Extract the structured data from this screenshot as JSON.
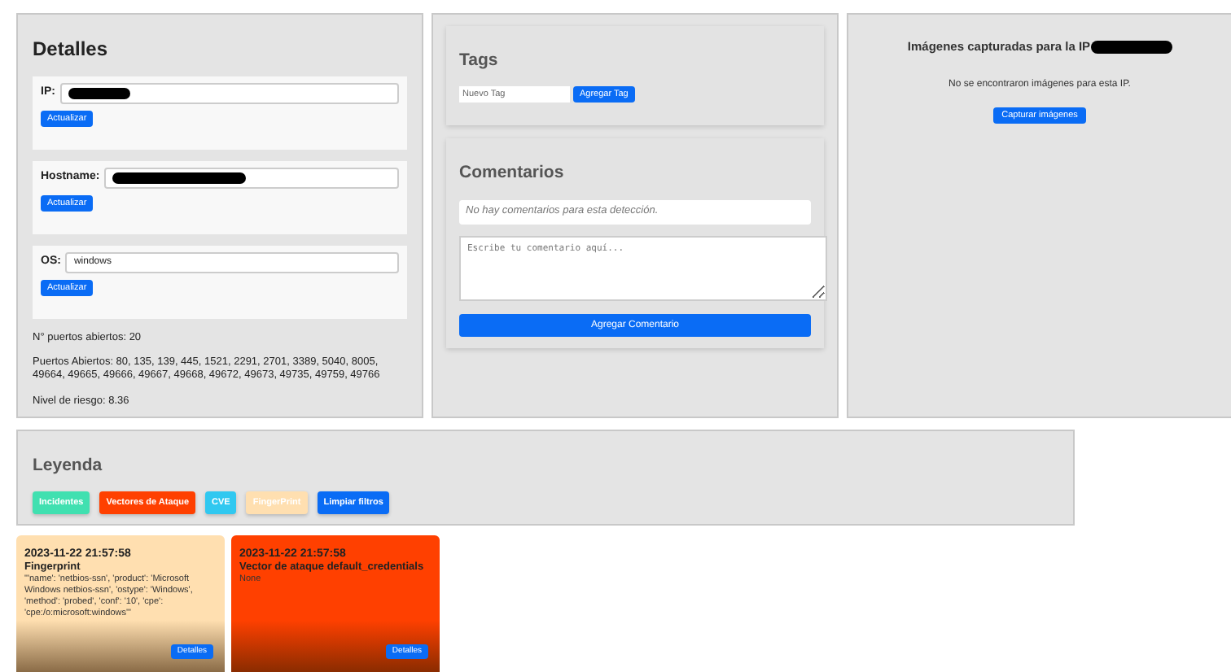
{
  "details": {
    "title": "Detalles",
    "fields": [
      {
        "label": "IP:",
        "value_redacted": true,
        "button": "Actualizar"
      },
      {
        "label": "Hostname:",
        "value_redacted": true,
        "button": "Actualizar"
      },
      {
        "label": "OS:",
        "value": "windows",
        "button": "Actualizar"
      }
    ],
    "open_ports_count": "N° puertos abiertos: 20",
    "open_ports": "Puertos Abiertos: 80, 135, 139, 445, 1521, 2291, 2701, 3389, 5040, 8005, 49664, 49665, 49666, 49667, 49668, 49672, 49673, 49735, 49759, 49766",
    "risk": "Nivel de riesgo: 8.36"
  },
  "tags": {
    "title": "Tags",
    "placeholder": "Nuevo Tag",
    "button": "Agregar Tag"
  },
  "comments": {
    "title": "Comentarios",
    "empty": "No hay comentarios para esta detección.",
    "placeholder": "Escribe tu comentario aquí...",
    "button": "Agregar Comentario"
  },
  "images": {
    "title": "Imágenes capturadas para la IP",
    "ip_redacted": true,
    "empty": "No se encontraron imágenes para esta IP.",
    "button": "Capturar imágenes"
  },
  "legend": {
    "title": "Leyenda",
    "items": [
      {
        "label": "Incidentes",
        "color": "#40e0b0"
      },
      {
        "label": "Vectores de Ataque",
        "color": "#ff4000"
      },
      {
        "label": "CVE",
        "color": "#30c8f0"
      },
      {
        "label": "FingerPrint",
        "color": "#ffdfb0"
      },
      {
        "label": "Limpiar filtros",
        "color": "#0a6cf5"
      }
    ]
  },
  "cards": [
    {
      "date": "2023-11-22 21:57:58",
      "title": "Fingerprint",
      "body": "\"'name': 'netbios-ssn', 'product': 'Microsoft Windows netbios-ssn', 'ostype': 'Windows', 'method': 'probed', 'conf': '10', 'cpe': 'cpe:/o:microsoft:windows'\"",
      "button": "Detalles",
      "color": "#ffdfb0"
    },
    {
      "date": "2023-11-22 21:57:58",
      "title": "Vector de ataque default_credentials",
      "body": "None",
      "button": "Detalles",
      "color": "#ff4000"
    }
  ]
}
